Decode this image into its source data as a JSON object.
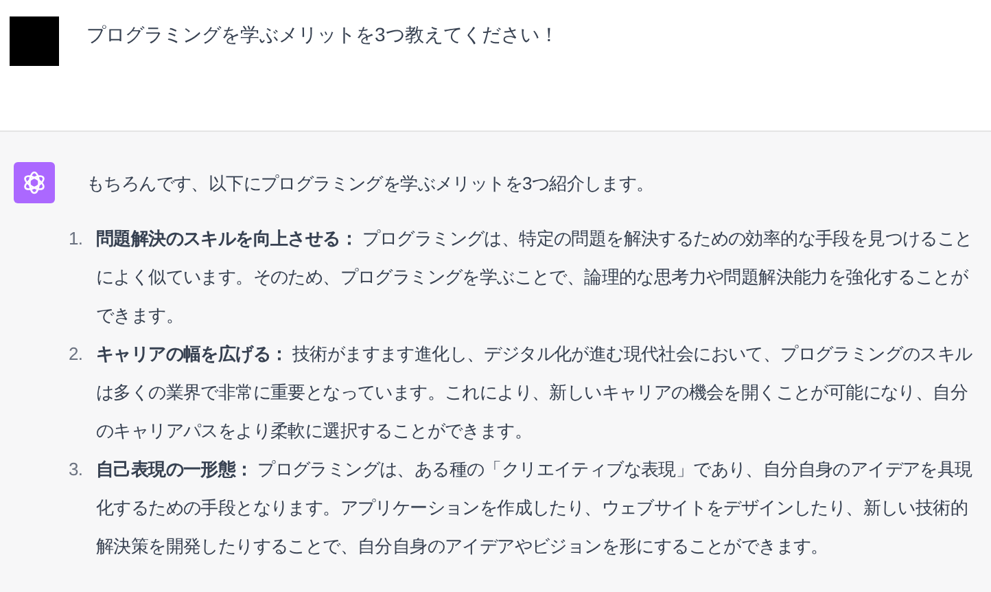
{
  "user_message": {
    "text": "プログラミングを学ぶメリットを3つ教えてください！"
  },
  "assistant_message": {
    "intro": "もちろんです、以下にプログラミングを学ぶメリットを3つ紹介します。",
    "items": [
      {
        "number": "1.",
        "text": "**問題解決のスキルを向上させる：** プログラミングは、特定の問題を解決するための効率的な手段を見つけることによく似ています。そのため、プログラミングを学ぶことで、論理的な思考力や問題解決能力を強化することができます。"
      },
      {
        "number": "2.",
        "text": "**キャリアの幅を広げる：** 技術がますます進化し、デジタル化が進む現代社会において、プログラミングのスキルは多くの業界で非常に重要となっています。これにより、新しいキャリアの機会を開くことが可能になり、自分のキャリアパスをより柔軟に選択することができます。"
      },
      {
        "number": "3.",
        "text": "**自己表現の一形態：** プログラミングは、ある種の「クリエイティブな表現」であり、自分自身のアイデアを具現化するための手段となります。アプリケーションを作成したり、ウェブサイトをデザインしたり、新しい技術的解決策を開発したりすることで、自分自身のアイデアやビジョンを形にすることができます。"
      }
    ]
  }
}
